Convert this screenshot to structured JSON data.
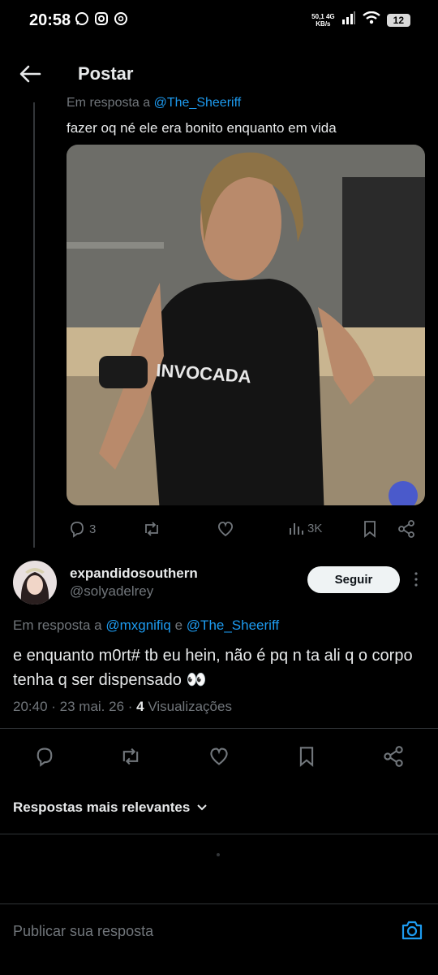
{
  "status_bar": {
    "time": "20:58",
    "speed_top": "50,1 4G",
    "speed_bottom": "KB/s",
    "battery": "12"
  },
  "header": {
    "title": "Postar"
  },
  "parent_tweet": {
    "reply_prefix": "Em resposta a ",
    "reply_handle": "@The_Sheeriff",
    "text": "fazer oq né ele era bonito enquanto em vida",
    "image_shirt_text": "INVOCADA",
    "replies": "3",
    "views": "3K"
  },
  "tweet": {
    "author_name": "expandidosouthern",
    "author_handle": "@solyadelrey",
    "follow_label": "Seguir",
    "reply_prefix": "Em resposta a ",
    "reply_handle_1": "@mxgnifiq",
    "reply_and": " e ",
    "reply_handle_2": "@The_Sheeriff",
    "text": "e enquanto m0rt# tb eu hein, não é pq n ta ali q o corpo tenha q ser dispensado 👀",
    "time": "20:40 · 23 mai. 26 · ",
    "views_count": "4",
    "views_label": " Visualizações"
  },
  "replies_section": {
    "sort_label": "Respostas mais relevantes"
  },
  "composer": {
    "placeholder": "Publicar sua resposta"
  },
  "colors": {
    "accent": "#1d9bf0",
    "muted": "#71767b",
    "text": "#e7e9ea",
    "background": "#000000"
  }
}
